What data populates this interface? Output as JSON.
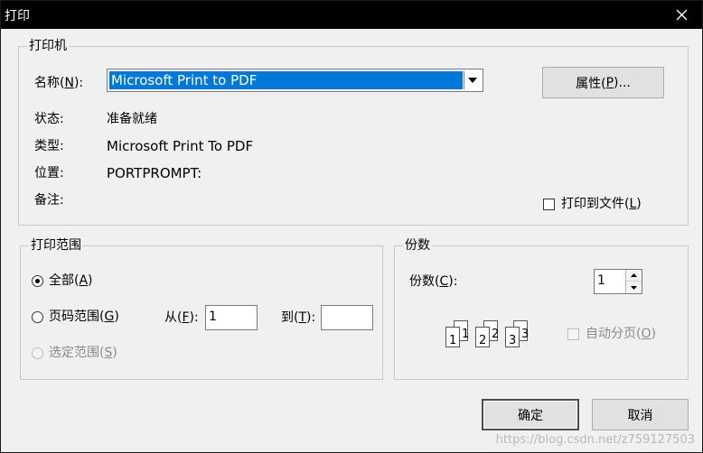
{
  "window": {
    "title": "打印"
  },
  "printer_group": {
    "legend": "打印机",
    "name_label_pre": "名称(",
    "name_label_key": "N",
    "name_label_post": "):",
    "selected_printer": "Microsoft Print to PDF",
    "properties_pre": "属性(",
    "properties_key": "P",
    "properties_post": ")...",
    "status_label": "状态:",
    "status_value": "准备就绪",
    "type_label": "类型:",
    "type_value": "Microsoft Print To PDF",
    "location_label": "位置:",
    "location_value": "PORTPROMPT:",
    "comment_label": "备注:",
    "print_to_file_pre": "打印到文件(",
    "print_to_file_key": "L",
    "print_to_file_post": ")",
    "print_to_file_checked": false
  },
  "range_group": {
    "legend": "打印范围",
    "all_pre": "全部(",
    "all_key": "A",
    "all_post": ")",
    "pages_pre": "页码范围(",
    "pages_key": "G",
    "pages_post": ")",
    "from_pre": "从(",
    "from_key": "F",
    "from_post": "):",
    "from_value": "1",
    "to_pre": "到(",
    "to_key": "T",
    "to_post": "):",
    "to_value": "",
    "selection_pre": "选定范围(",
    "selection_key": "S",
    "selection_post": ")",
    "selected_option": "all"
  },
  "copies_group": {
    "legend": "份数",
    "copies_pre": "份数(",
    "copies_key": "C",
    "copies_post": "):",
    "copies_value": "1",
    "collate_pre": "自动分页(",
    "collate_key": "O",
    "collate_post": ")",
    "collate_checked": false,
    "collate_page_numbers": [
      "1",
      "2",
      "3"
    ]
  },
  "buttons": {
    "ok": "确定",
    "cancel": "取消"
  },
  "watermark": "https://blog.csdn.net/z759127503",
  "icons": {
    "close": "close-icon",
    "dropdown": "chevron-down-icon",
    "spin_up": "arrow-up-icon",
    "spin_down": "arrow-down-icon"
  },
  "colors": {
    "selection": "#0078d7",
    "titlebar": "#000000",
    "dialog_bg": "#f0f0f0"
  }
}
